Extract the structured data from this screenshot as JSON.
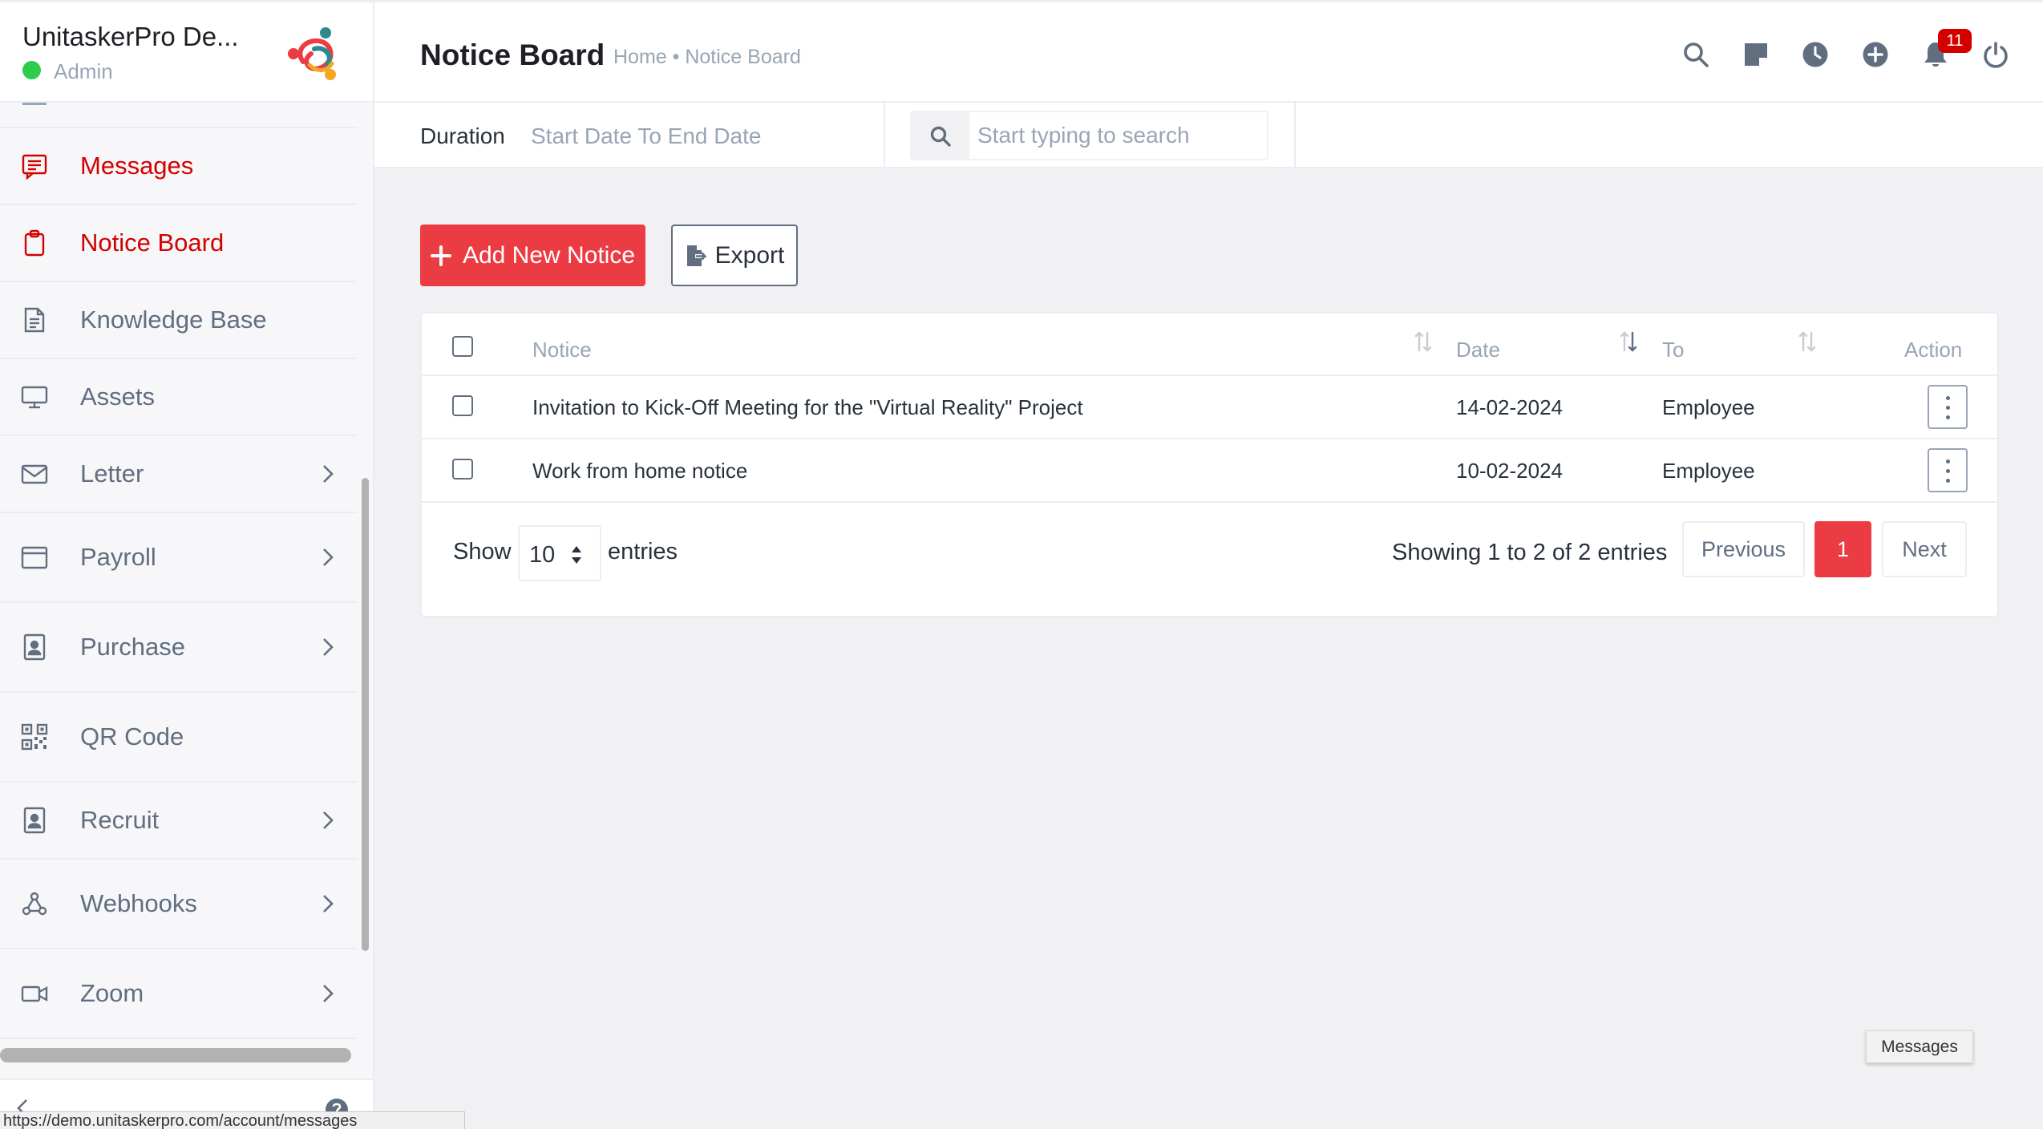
{
  "sidebar": {
    "company_name": "UnitaskerPro De...",
    "user_role": "Admin",
    "items": [
      {
        "label": "Messages",
        "icon": "chat-icon",
        "active": true
      },
      {
        "label": "Notice Board",
        "icon": "clipboard-icon",
        "active": true
      },
      {
        "label": "Knowledge Base",
        "icon": "document-icon"
      },
      {
        "label": "Assets",
        "icon": "monitor-icon"
      },
      {
        "label": "Letter",
        "icon": "envelope-icon",
        "has_submenu": true
      },
      {
        "label": "Payroll",
        "icon": "wallet-icon",
        "has_submenu": true
      },
      {
        "label": "Purchase",
        "icon": "id-card-icon",
        "has_submenu": true
      },
      {
        "label": "QR Code",
        "icon": "qr-code-icon"
      },
      {
        "label": "Recruit",
        "icon": "id-badge-icon",
        "has_submenu": true
      },
      {
        "label": "Webhooks",
        "icon": "webhook-icon",
        "has_submenu": true
      },
      {
        "label": "Zoom",
        "icon": "video-camera-icon",
        "has_submenu": true
      }
    ]
  },
  "header": {
    "title": "Notice Board",
    "breadcrumb": "Home • Notice Board",
    "notification_count": "11",
    "icons": [
      "search-icon",
      "sticky-note-icon",
      "clock-icon",
      "plus-circle-icon",
      "bell-icon",
      "power-icon"
    ]
  },
  "filters": {
    "duration_label": "Duration",
    "duration_value": "Start Date To End Date",
    "search_placeholder": "Start typing to search"
  },
  "actions": {
    "add_label": "Add New Notice",
    "export_label": "Export"
  },
  "table": {
    "columns": [
      "Notice",
      "Date",
      "To",
      "Action"
    ],
    "rows": [
      {
        "notice": "Invitation to Kick-Off Meeting for the \"Virtual Reality\" Project",
        "date": "14-02-2024",
        "to": "Employee"
      },
      {
        "notice": "Work from home notice",
        "date": "10-02-2024",
        "to": "Employee"
      }
    ],
    "show_label": "Show",
    "page_length": "10",
    "entries_label": "entries",
    "info": "Showing 1 to 2 of 2 entries",
    "pagination": {
      "previous": "Previous",
      "current": "1",
      "next": "Next"
    }
  },
  "status_url": "https://demo.unitaskerpro.com/account/messages",
  "tooltip": "Messages",
  "colors": {
    "accent": "#ec3c43",
    "active_text": "#d30000",
    "online": "#2fcb4a"
  }
}
